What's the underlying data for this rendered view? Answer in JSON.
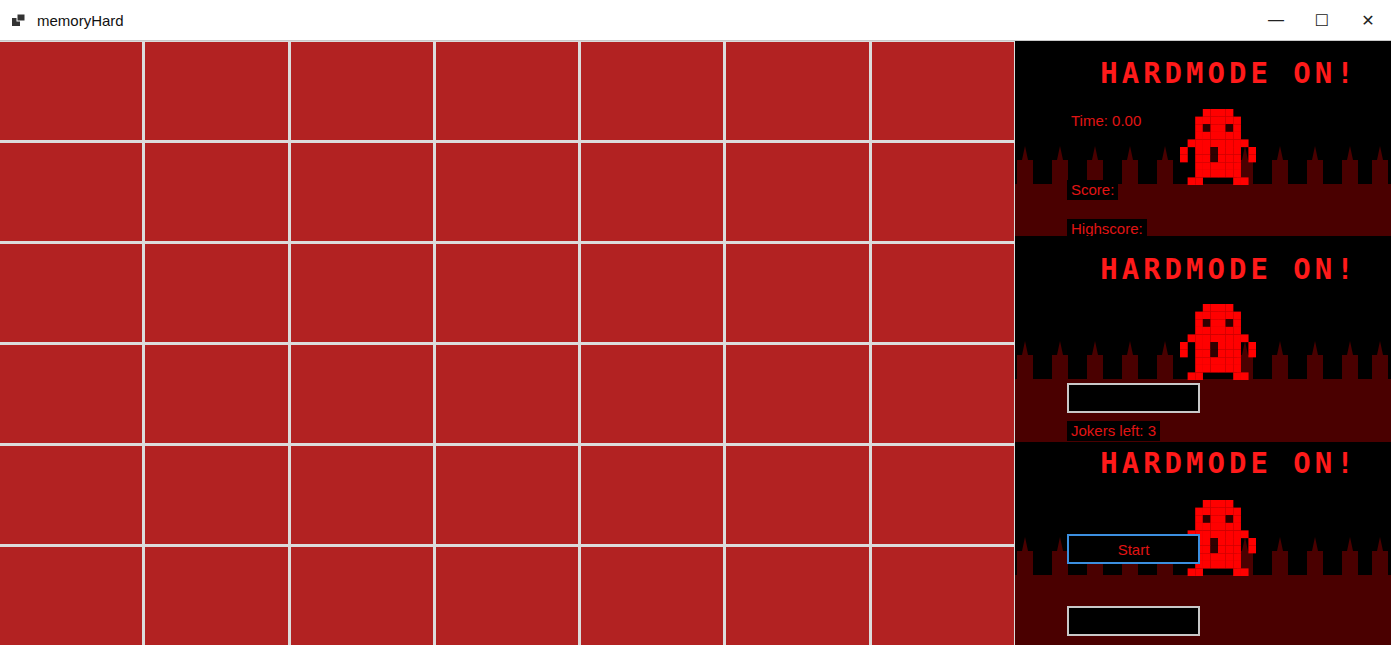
{
  "window": {
    "title": "memoryHard",
    "controls": [
      "—",
      "☐",
      "✕"
    ]
  },
  "board": {
    "rows": [
      [
        {
          "face_up": false
        },
        {
          "face_up": false
        },
        {
          "face_up": false
        },
        {
          "face_up": false
        },
        {
          "face_up": false
        },
        {
          "face_up": false
        },
        {
          "face_up": false
        }
      ],
      [
        {
          "face_up": false
        },
        {
          "face_up": false
        },
        {
          "face_up": false
        },
        {
          "face_up": false
        },
        {
          "face_up": false
        },
        {
          "face_up": false
        },
        {
          "face_up": false
        }
      ],
      [
        {
          "face_up": false
        },
        {
          "face_up": false
        },
        {
          "face_up": false
        },
        {
          "face_up": false
        },
        {
          "face_up": false
        },
        {
          "face_up": false
        },
        {
          "face_up": false
        }
      ],
      [
        {
          "face_up": false
        },
        {
          "face_up": false
        },
        {
          "face_up": false
        },
        {
          "face_up": false
        },
        {
          "face_up": false
        },
        {
          "face_up": false
        },
        {
          "face_up": false
        }
      ],
      [
        {
          "face_up": false
        },
        {
          "face_up": false
        },
        {
          "face_up": false
        },
        {
          "face_up": false
        },
        {
          "face_up": false
        },
        {
          "face_up": false
        },
        {
          "face_up": false
        }
      ],
      [
        {
          "face_up": false
        },
        {
          "face_up": false
        },
        {
          "face_up": false
        },
        {
          "face_up": false
        },
        {
          "face_up": false
        },
        {
          "face_up": false
        },
        {
          "face_up": false
        }
      ]
    ]
  },
  "side_panels": [
    {
      "banner": "HARDMODE ON!"
    },
    {
      "banner": "HARDMODE ON!"
    },
    {
      "banner": "HARDMODE ON!"
    }
  ],
  "stats": {
    "time": "Time: 0.00",
    "score": "Score:",
    "highscore": "Highscore:"
  },
  "name_field": {
    "value": ""
  },
  "jokers": "Jokers left: 3",
  "start_button": {
    "label": "Start",
    "focused": true
  },
  "bottom_field": {
    "value": ""
  }
}
